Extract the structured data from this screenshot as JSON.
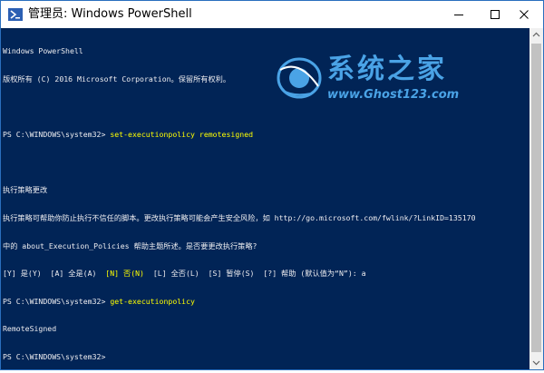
{
  "window": {
    "title": "管理员: Windows PowerShell",
    "controls": {
      "minimize": "minimize-icon",
      "maximize": "maximize-icon",
      "close": "close-icon"
    }
  },
  "colors": {
    "background": "#012456",
    "text": "#eeedf0",
    "command": "#ffff00",
    "watermark": "#4aa3e6"
  },
  "watermark": {
    "title": "系统之家",
    "url": "www.Ghost123.com"
  },
  "console": {
    "header1": "Windows PowerShell",
    "header2": "版权所有 (C) 2016 Microsoft Corporation。保留所有权利。",
    "prompt1": "PS C:\\WINDOWS\\system32> ",
    "command1": "set-executionpolicy remotesigned",
    "policy_title": "执行策略更改",
    "policy_text1": "执行策略可帮助你防止执行不信任的脚本。更改执行策略可能会产生安全风险，如 http://go.microsoft.com/fwlink/?LinkID=135170",
    "policy_text2": "中的 about_Execution_Policies 帮助主题所述。是否要更改执行策略?",
    "options_pre": "[Y] 是(Y)  [A] 全是(A)  ",
    "options_default": "[N] 否(N)",
    "options_post": "  [L] 全否(L)  [S] 暂停(S)  [?] 帮助 (默认值为“N”): a",
    "prompt2": "PS C:\\WINDOWS\\system32> ",
    "command2": "get-executionpolicy",
    "output": "RemoteSigned",
    "prompt3": "PS C:\\WINDOWS\\system32>"
  }
}
